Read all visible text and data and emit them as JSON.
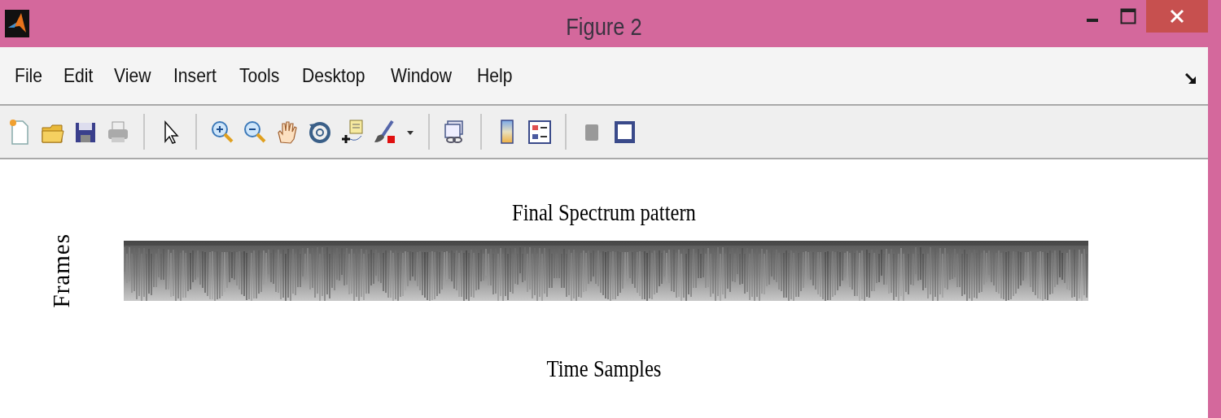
{
  "window": {
    "title": "Figure 2"
  },
  "menu": [
    "File",
    "Edit",
    "View",
    "Insert",
    "Tools",
    "Desktop",
    "Window",
    "Help"
  ],
  "figure": {
    "title": "Final Spectrum pattern",
    "ylabel": "Frames",
    "xlabel": "Time Samples"
  }
}
